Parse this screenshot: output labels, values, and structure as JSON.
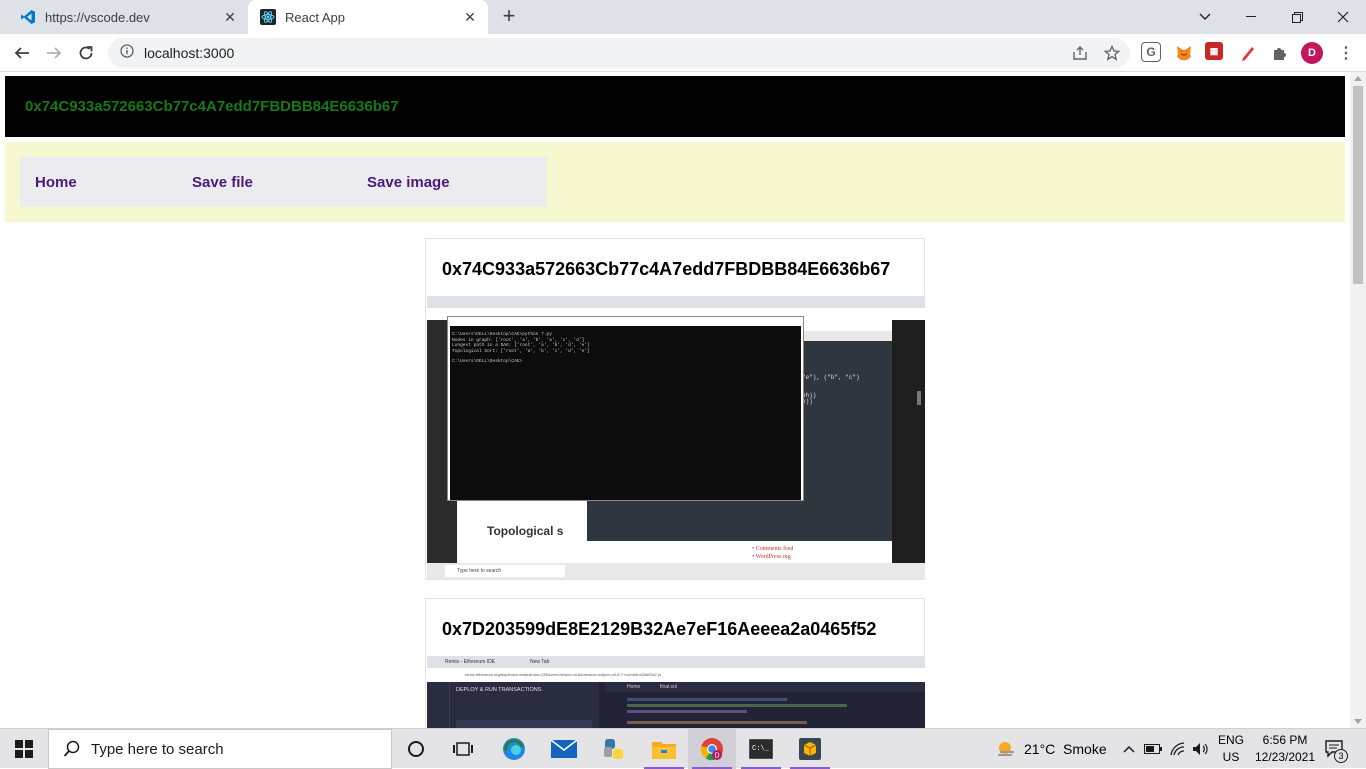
{
  "browser": {
    "tabs": [
      {
        "title": "https://vscode.dev",
        "icon": "vscode-icon"
      },
      {
        "title": "React App",
        "icon": "react-icon"
      }
    ],
    "url": "localhost:3000"
  },
  "app": {
    "account": "0x74C933a572663Cb77c4A7edd7FBDBB84E6636b67",
    "nav": {
      "home": "Home",
      "save_file": "Save file",
      "save_image": "Save image"
    },
    "cards": [
      {
        "title": "0x74C933a572663Cb77c4A7edd7FBDBB84E6636b67",
        "terminal_lines": [
          "C:\\Users\\DELL\\Desktop\\CAE>python 7.py",
          "Nodes in graph: ['root', 'a', 'b', 'a', 'c', 'd']",
          "Longest path in a DAG: ['root', 'a', 'b', 'd', 'e']",
          "Topological Sort: ['root', 'a', 'b', 'c', 'd', 'e']",
          "C:\\Users\\DELL\\Desktop\\CAE>"
        ],
        "doc_heading": "Topological s",
        "taskbar_search": "Type here to search"
      },
      {
        "title": "0x7D203599dE8E2129B32Ae7eF16Aeeea2a0465f52",
        "tab1": "Remix - Ethereum IDE",
        "tab2": "New Tab",
        "url": "remix.ethereum.org/#optimize=false&runs=200&evmVersion=null&version=soljson-v0.8.7+commit.e28d00a7.js",
        "panel_title": "DEPLOY & RUN TRANSACTIONS",
        "home_tab": "Home",
        "file_tab": "final.sol"
      }
    ]
  },
  "taskbar": {
    "search_placeholder": "Type here to search",
    "weather": "21°C  Smoke",
    "lang": "ENG",
    "region": "US",
    "time": "6:56 PM",
    "date": "12/23/2021",
    "notifications": "3"
  }
}
